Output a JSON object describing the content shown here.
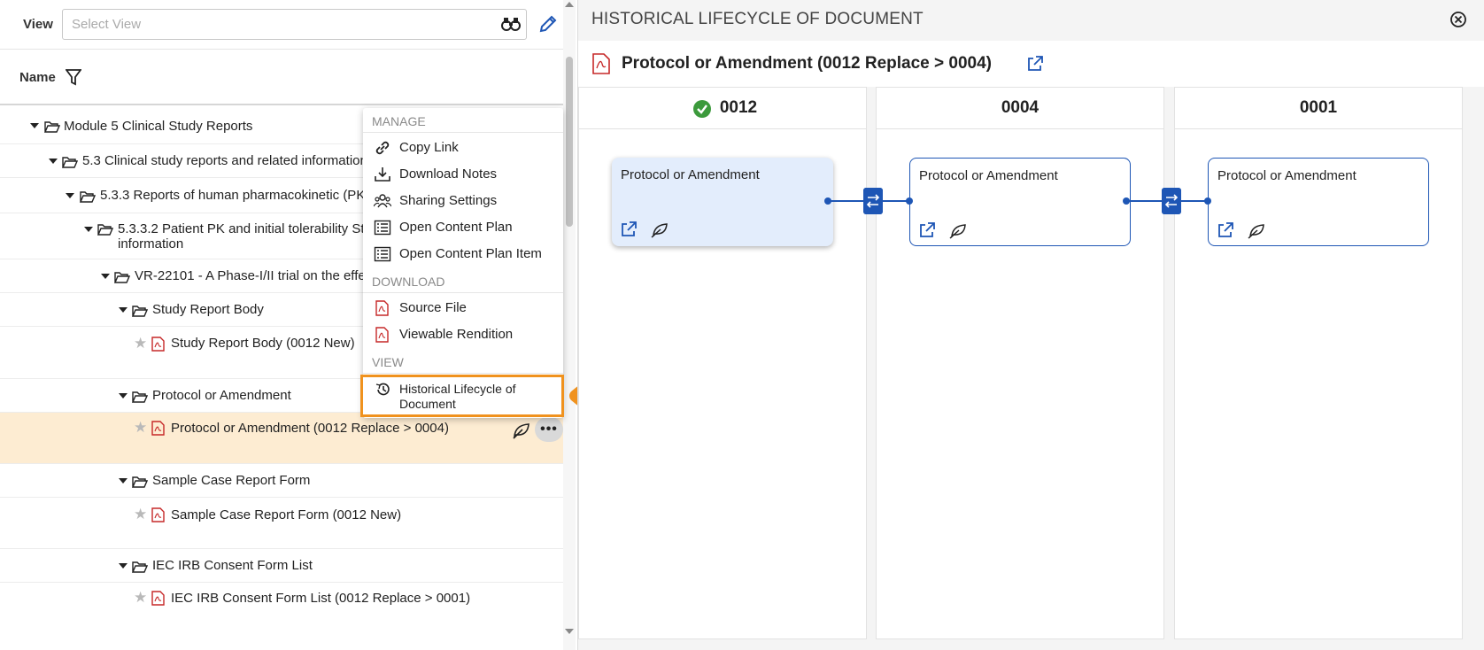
{
  "view": {
    "label": "View",
    "placeholder": "Select View"
  },
  "tree_header": {
    "name_label": "Name"
  },
  "tree": {
    "rows": [
      {
        "label": "Module 5 Clinical Study Reports",
        "type": "folder"
      },
      {
        "label": "5.3 Clinical study reports and related information",
        "type": "folder"
      },
      {
        "label": "5.3.3 Reports of human pharmacokinetic (PK",
        "type": "folder"
      },
      {
        "label": "5.3.3.2 Patient PK and initial tolerability St",
        "label2": "information",
        "type": "folder"
      },
      {
        "label": "VR-22101 - A Phase-I/II trial on the effe",
        "type": "folder"
      },
      {
        "label": "Study Report Body",
        "type": "folder"
      },
      {
        "label": "Study Report Body (0012 New)",
        "type": "document"
      },
      {
        "label": "Protocol or Amendment",
        "type": "folder"
      },
      {
        "label": "Protocol or Amendment (0012 Replace > 0004)",
        "type": "document",
        "selected": true
      },
      {
        "label": "Sample Case Report Form",
        "type": "folder"
      },
      {
        "label": "Sample Case Report Form (0012 New)",
        "type": "document"
      },
      {
        "label": "IEC IRB Consent Form List",
        "type": "folder"
      },
      {
        "label": "IEC IRB Consent Form List (0012 Replace > 0001)",
        "type": "document"
      }
    ]
  },
  "context_menu": {
    "sections": [
      {
        "title": "MANAGE",
        "items": [
          "Copy Link",
          "Download Notes",
          "Sharing Settings",
          "Open Content Plan",
          "Open Content Plan Item"
        ]
      },
      {
        "title": "DOWNLOAD",
        "items": [
          "Source File",
          "Viewable Rendition"
        ]
      },
      {
        "title": "VIEW",
        "items": [
          "Historical Lifecycle of Document"
        ]
      }
    ],
    "highlighted_item": "Historical Lifecycle of Document"
  },
  "more_button_label": "•••",
  "lifecycle": {
    "title": "HISTORICAL LIFECYCLE OF DOCUMENT",
    "document_title": "Protocol or Amendment (0012 Replace > 0004)",
    "columns": [
      {
        "sequence": "0012",
        "current": true,
        "card_title": "Protocol or Amendment"
      },
      {
        "sequence": "0004",
        "current": false,
        "card_title": "Protocol or Amendment"
      },
      {
        "sequence": "0001",
        "current": false,
        "card_title": "Protocol or Amendment"
      }
    ]
  },
  "colors": {
    "accent_blue": "#1e56b5",
    "highlight_orange": "#f0921e",
    "selected_row": "#fdecd2",
    "pdf_red": "#c62828",
    "success_green": "#3c9a3c"
  }
}
